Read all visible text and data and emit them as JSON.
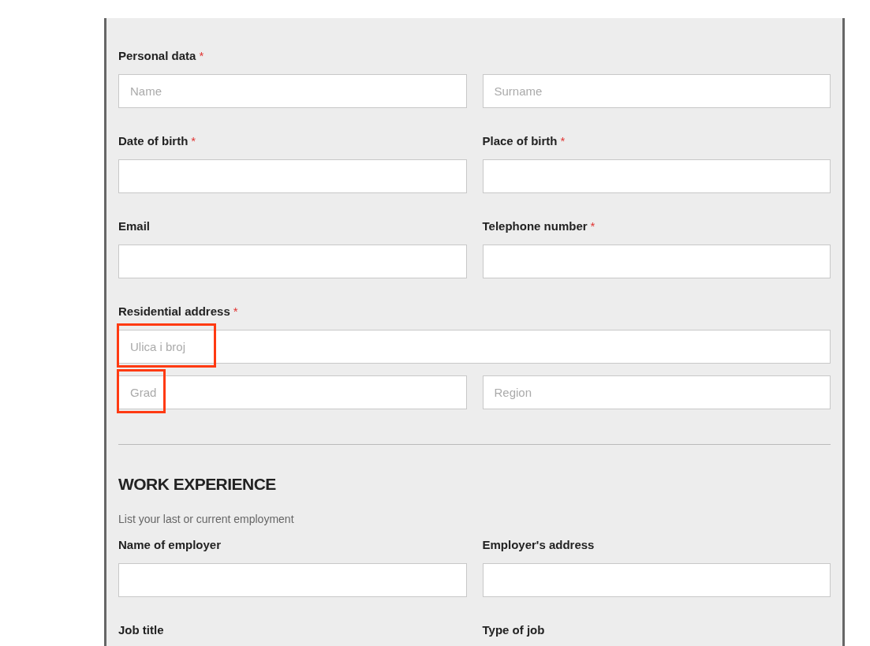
{
  "personal": {
    "rows": [
      {
        "label": "Personal data",
        "mark": "*",
        "lines": [
          [
            {
              "placeholder": "Name",
              "highlighted": false
            },
            {
              "placeholder": "Surname",
              "highlighted": false
            }
          ]
        ]
      },
      {
        "lines": [
          [
            {
              "label": "Date of birth",
              "mark": "*",
              "highlighted": false
            },
            {
              "label": "Place of birth",
              "mark": "*",
              "highlighted": false
            }
          ]
        ]
      },
      {
        "lines": [
          [
            {
              "label": "Email",
              "highlighted": false
            },
            {
              "label": "Telephone number",
              "mark": "*",
              "highlighted": false
            }
          ]
        ]
      },
      {
        "label": "Residential address",
        "mark": "*",
        "lines": [
          [
            {
              "placeholder": "Ulica i broj",
              "highlighted": true
            }
          ],
          [
            {
              "placeholder": "Grad",
              "highlighted": true
            },
            {
              "placeholder": "Region",
              "highlighted": false
            }
          ]
        ]
      }
    ]
  },
  "work": {
    "title": "WORK EXPERIENCE",
    "subtitle": "List your last or current employment",
    "rows": [
      {
        "lines": [
          [
            {
              "label": "Name of employer",
              "highlighted": false
            },
            {
              "label": "Employer's address",
              "highlighted": false
            }
          ]
        ]
      },
      {
        "lines": [
          [
            {
              "label": "Job title"
            },
            {
              "label": "Type of job"
            }
          ]
        ]
      }
    ]
  }
}
